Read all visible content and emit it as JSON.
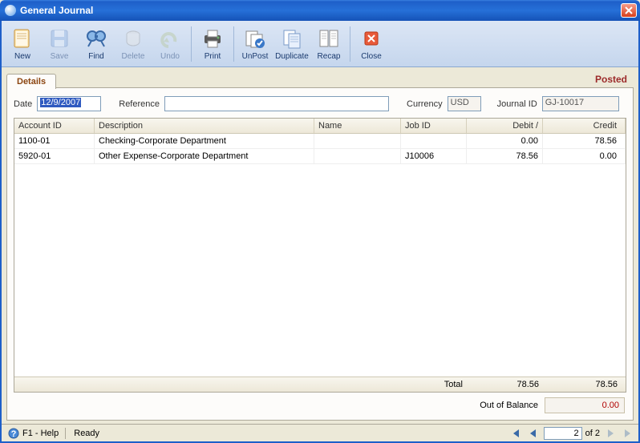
{
  "window": {
    "title": "General Journal"
  },
  "toolbar": {
    "new": "New",
    "save": "Save",
    "find": "Find",
    "delete": "Delete",
    "undo": "Undo",
    "print": "Print",
    "unpost": "UnPost",
    "duplicate": "Duplicate",
    "recap": "Recap",
    "close": "Close"
  },
  "tabs": {
    "details": "Details",
    "status": "Posted"
  },
  "form": {
    "date_label": "Date",
    "date_value": "12/9/2007",
    "reference_label": "Reference",
    "reference_value": "",
    "currency_label": "Currency",
    "currency_value": "USD",
    "journal_id_label": "Journal ID",
    "journal_id_value": "GJ-10017"
  },
  "grid": {
    "headers": {
      "account_id": "Account ID",
      "description": "Description",
      "name": "Name",
      "job_id": "Job ID",
      "debit": "Debit /",
      "credit": "Credit"
    },
    "rows": [
      {
        "account_id": "1100-01",
        "description": "Checking-Corporate Department",
        "name": "",
        "job_id": "",
        "debit": "0.00",
        "credit": "78.56"
      },
      {
        "account_id": "5920-01",
        "description": "Other Expense-Corporate Department",
        "name": "",
        "job_id": "J10006",
        "debit": "78.56",
        "credit": "0.00"
      }
    ],
    "total_label": "Total",
    "total_debit": "78.56",
    "total_credit": "78.56"
  },
  "out_of_balance": {
    "label": "Out of Balance",
    "value": "0.00"
  },
  "statusbar": {
    "help": "F1 - Help",
    "ready": "Ready",
    "page": "2",
    "of": "of  2"
  }
}
